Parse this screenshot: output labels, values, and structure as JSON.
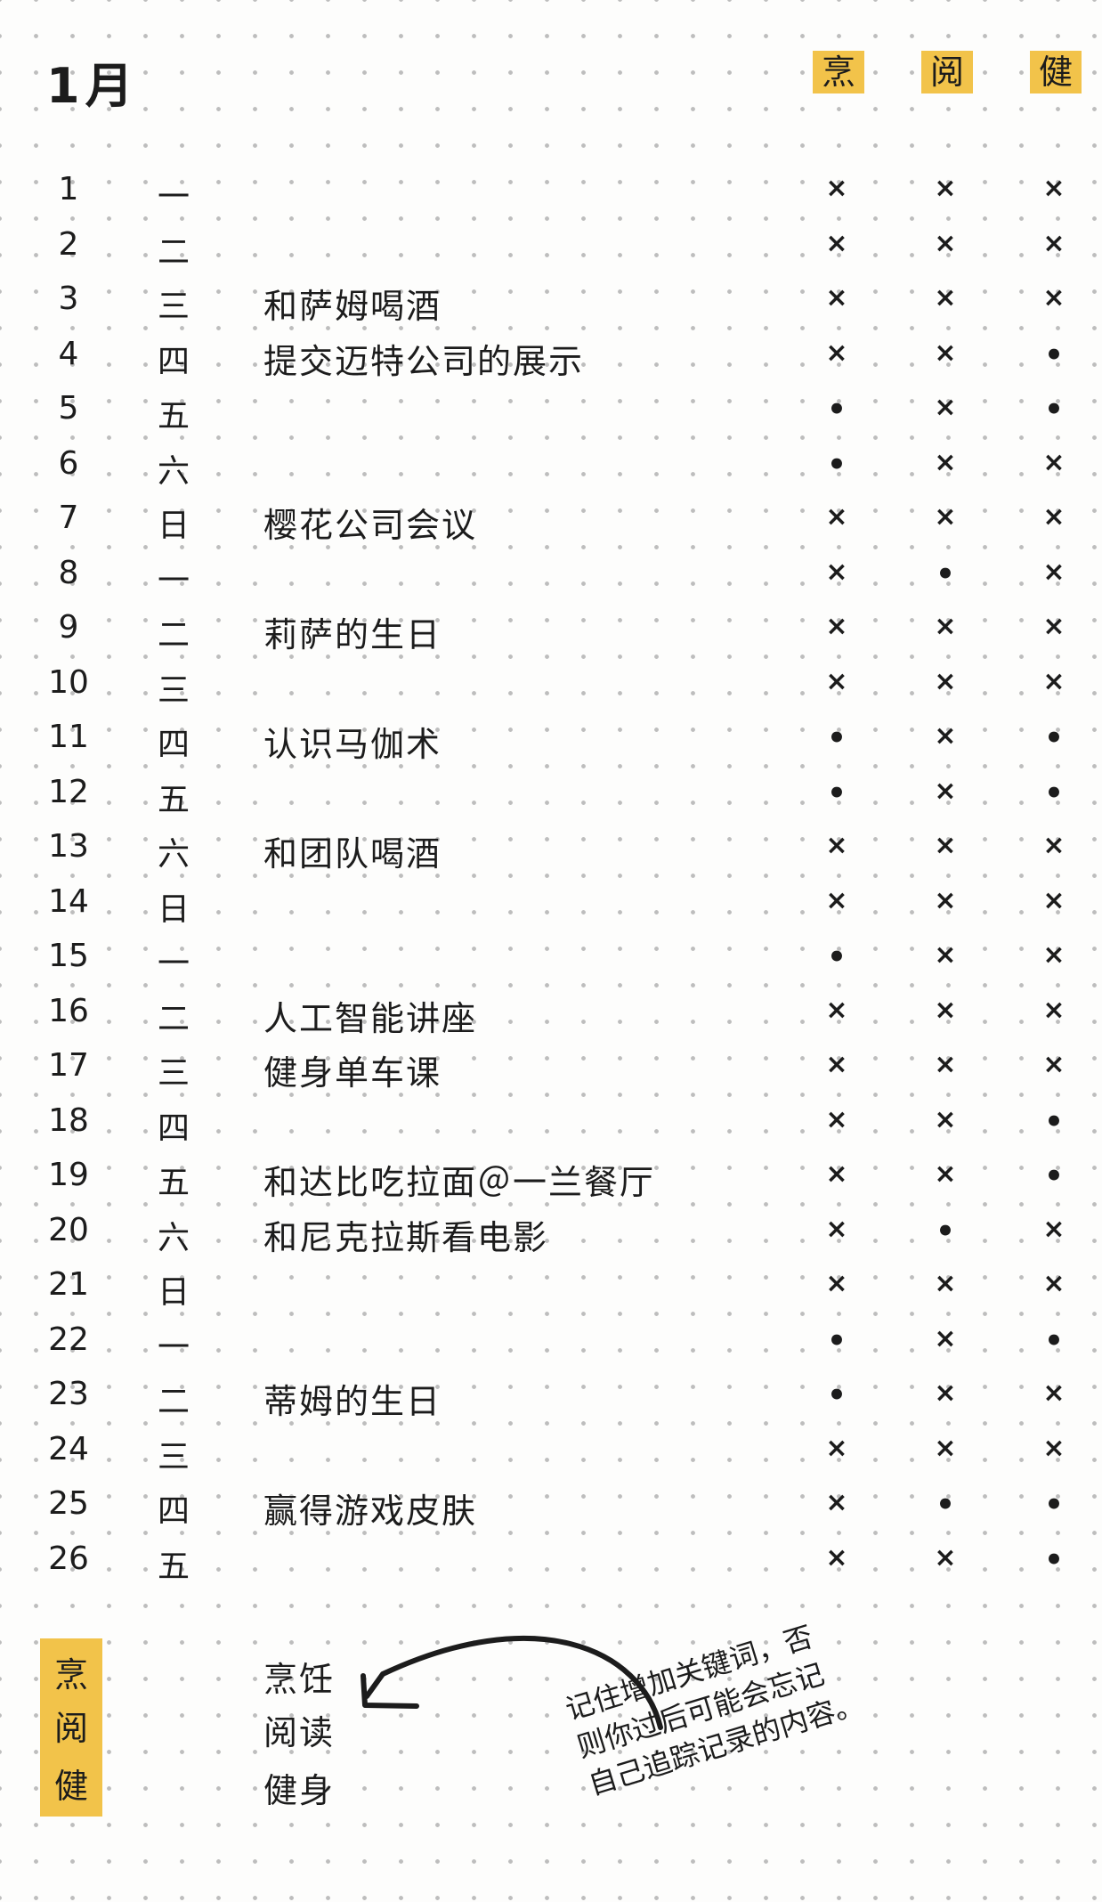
{
  "month": "1月",
  "headers": {
    "cook": "烹",
    "read": "阅",
    "fit": "健"
  },
  "rows": [
    {
      "day": "1",
      "weekday": "一",
      "event": "",
      "cook": "×",
      "read": "×",
      "fit": "×"
    },
    {
      "day": "2",
      "weekday": "二",
      "event": "",
      "cook": "×",
      "read": "×",
      "fit": "×"
    },
    {
      "day": "3",
      "weekday": "三",
      "event": "和萨姆喝酒",
      "cook": "×",
      "read": "×",
      "fit": "×"
    },
    {
      "day": "4",
      "weekday": "四",
      "event": "提交迈特公司的展示",
      "cook": "×",
      "read": "×",
      "fit": "•"
    },
    {
      "day": "5",
      "weekday": "五",
      "event": "",
      "cook": "•",
      "read": "×",
      "fit": "•"
    },
    {
      "day": "6",
      "weekday": "六",
      "event": "",
      "cook": "•",
      "read": "×",
      "fit": "×"
    },
    {
      "day": "7",
      "weekday": "日",
      "event": "樱花公司会议",
      "cook": "×",
      "read": "×",
      "fit": "×"
    },
    {
      "day": "8",
      "weekday": "一",
      "event": "",
      "cook": "×",
      "read": "•",
      "fit": "×"
    },
    {
      "day": "9",
      "weekday": "二",
      "event": "莉萨的生日",
      "cook": "×",
      "read": "×",
      "fit": "×"
    },
    {
      "day": "10",
      "weekday": "三",
      "event": "",
      "cook": "×",
      "read": "×",
      "fit": "×"
    },
    {
      "day": "11",
      "weekday": "四",
      "event": "认识马伽术",
      "cook": "•",
      "read": "×",
      "fit": "•"
    },
    {
      "day": "12",
      "weekday": "五",
      "event": "",
      "cook": "•",
      "read": "×",
      "fit": "•"
    },
    {
      "day": "13",
      "weekday": "六",
      "event": "和团队喝酒",
      "cook": "×",
      "read": "×",
      "fit": "×"
    },
    {
      "day": "14",
      "weekday": "日",
      "event": "",
      "cook": "×",
      "read": "×",
      "fit": "×"
    },
    {
      "day": "15",
      "weekday": "一",
      "event": "",
      "cook": "•",
      "read": "×",
      "fit": "×"
    },
    {
      "day": "16",
      "weekday": "二",
      "event": "人工智能讲座",
      "cook": "×",
      "read": "×",
      "fit": "×"
    },
    {
      "day": "17",
      "weekday": "三",
      "event": "健身单车课",
      "cook": "×",
      "read": "×",
      "fit": "×"
    },
    {
      "day": "18",
      "weekday": "四",
      "event": "",
      "cook": "×",
      "read": "×",
      "fit": "•"
    },
    {
      "day": "19",
      "weekday": "五",
      "event": "和达比吃拉面＠一兰餐厅",
      "cook": "×",
      "read": "×",
      "fit": "•"
    },
    {
      "day": "20",
      "weekday": "六",
      "event": "和尼克拉斯看电影",
      "cook": "×",
      "read": "•",
      "fit": "×"
    },
    {
      "day": "21",
      "weekday": "日",
      "event": "",
      "cook": "×",
      "read": "×",
      "fit": "×"
    },
    {
      "day": "22",
      "weekday": "一",
      "event": "",
      "cook": "•",
      "read": "×",
      "fit": "•"
    },
    {
      "day": "23",
      "weekday": "二",
      "event": "蒂姆的生日",
      "cook": "•",
      "read": "×",
      "fit": "×"
    },
    {
      "day": "24",
      "weekday": "三",
      "event": "",
      "cook": "×",
      "read": "×",
      "fit": "×"
    },
    {
      "day": "25",
      "weekday": "四",
      "event": "赢得游戏皮肤",
      "cook": "×",
      "read": "•",
      "fit": "•"
    },
    {
      "day": "26",
      "weekday": "五",
      "event": "",
      "cook": "×",
      "read": "×",
      "fit": "•"
    }
  ],
  "legend": [
    {
      "icon": "烹",
      "label": "烹饪"
    },
    {
      "icon": "阅",
      "label": "阅读"
    },
    {
      "icon": "健",
      "label": "健身"
    }
  ],
  "note": [
    "记住增加关键词，否",
    "则你过后可能会忘记",
    "自己追踪记录的内容。"
  ]
}
